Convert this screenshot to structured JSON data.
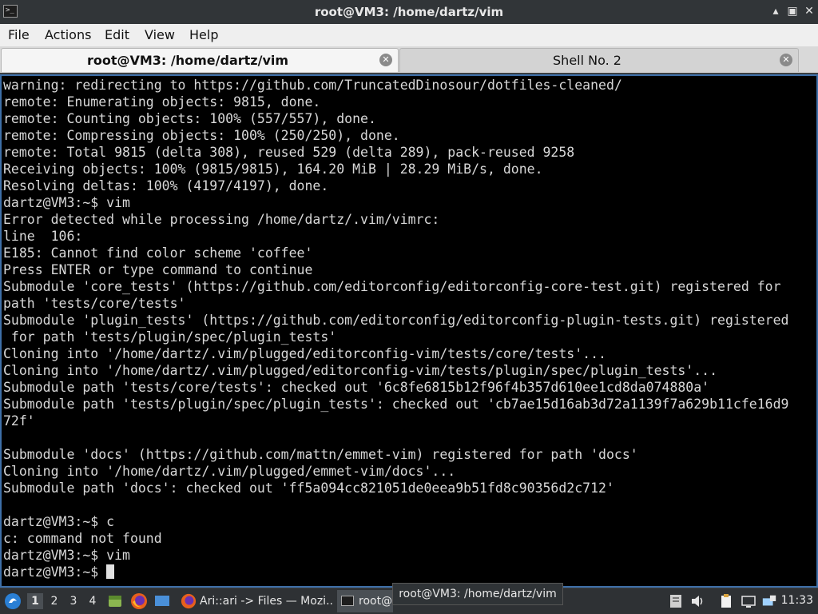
{
  "window": {
    "title": "root@VM3: /home/dartz/vim",
    "app_icon_glyph": ">_",
    "controls": [
      "minimize-icon",
      "maximize-icon",
      "close-icon"
    ]
  },
  "menu": [
    "File",
    "Actions",
    "Edit",
    "View",
    "Help"
  ],
  "tabs": [
    {
      "label": "root@VM3: /home/dartz/vim",
      "active": true
    },
    {
      "label": "Shell No. 2",
      "active": false
    }
  ],
  "terminal": {
    "lines": [
      "warning: redirecting to https://github.com/TruncatedDinosour/dotfiles-cleaned/",
      "remote: Enumerating objects: 9815, done.",
      "remote: Counting objects: 100% (557/557), done.",
      "remote: Compressing objects: 100% (250/250), done.",
      "remote: Total 9815 (delta 308), reused 529 (delta 289), pack-reused 9258",
      "Receiving objects: 100% (9815/9815), 164.20 MiB | 28.29 MiB/s, done.",
      "Resolving deltas: 100% (4197/4197), done.",
      "dartz@VM3:~$ vim",
      "Error detected while processing /home/dartz/.vim/vimrc:",
      "line  106:",
      "E185: Cannot find color scheme 'coffee'",
      "Press ENTER or type command to continue",
      "Submodule 'core_tests' (https://github.com/editorconfig/editorconfig-core-test.git) registered for",
      "path 'tests/core/tests'",
      "Submodule 'plugin_tests' (https://github.com/editorconfig/editorconfig-plugin-tests.git) registered",
      " for path 'tests/plugin/spec/plugin_tests'",
      "Cloning into '/home/dartz/.vim/plugged/editorconfig-vim/tests/core/tests'...",
      "Cloning into '/home/dartz/.vim/plugged/editorconfig-vim/tests/plugin/spec/plugin_tests'...",
      "Submodule path 'tests/core/tests': checked out '6c8fe6815b12f96f4b357d610ee1cd8da074880a'",
      "Submodule path 'tests/plugin/spec/plugin_tests': checked out 'cb7ae15d16ab3d72a1139f7a629b11cfe16d9",
      "72f'",
      "",
      "Submodule 'docs' (https://github.com/mattn/emmet-vim) registered for path 'docs'",
      "Cloning into '/home/dartz/.vim/plugged/emmet-vim/docs'...",
      "Submodule path 'docs': checked out 'ff5a094cc821051de0eea9b51fd8c90356d2c712'",
      "",
      "dartz@VM3:~$ c",
      "c: command not found",
      "dartz@VM3:~$ vim"
    ],
    "prompt": "dartz@VM3:~$ "
  },
  "taskbar": {
    "workspaces": [
      "1",
      "2",
      "3",
      "4"
    ],
    "active_workspace": "1",
    "tasks": [
      {
        "label": "Ari::ari -> Files — Mozi...",
        "icon": "firefox-icon"
      },
      {
        "label": "root@",
        "icon": "terminal-icon"
      }
    ],
    "tooltip": "root@VM3: /home/dartz/vim",
    "clock": "11:33"
  }
}
